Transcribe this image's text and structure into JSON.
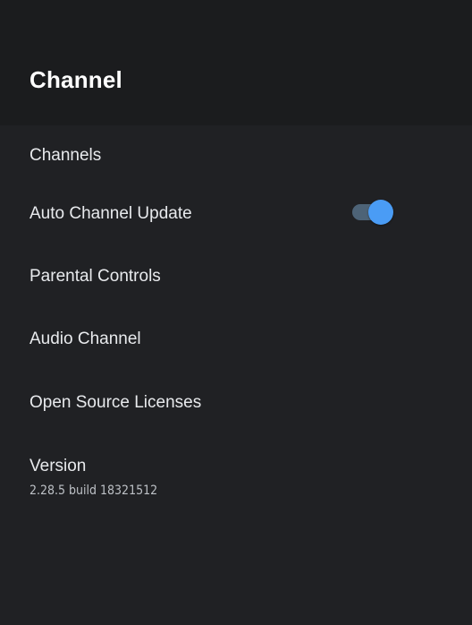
{
  "header": {
    "title": "Channel"
  },
  "menu": {
    "items": [
      {
        "label": "Channels"
      },
      {
        "label": "Auto Channel Update",
        "toggle_on": true
      },
      {
        "label": "Parental Controls"
      },
      {
        "label": "Audio Channel"
      },
      {
        "label": "Open Source Licenses"
      },
      {
        "label": "Version",
        "sublabel": "2.28.5 build 18321512"
      }
    ]
  },
  "colors": {
    "background": "#202124",
    "header_background": "#1b1c1e",
    "toggle_thumb": "#4a9cf5",
    "toggle_track": "#4d6377"
  }
}
